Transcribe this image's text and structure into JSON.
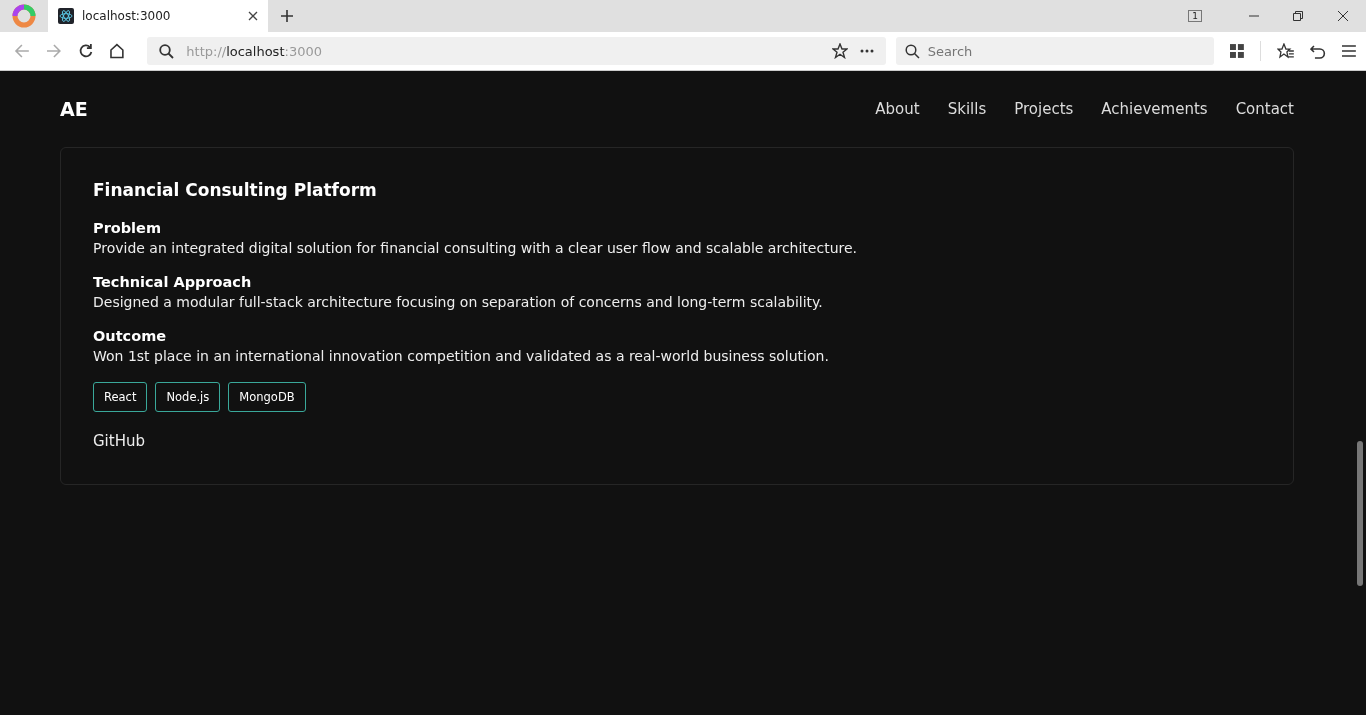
{
  "browser": {
    "tab": {
      "title": "localhost:3000"
    },
    "tab_count": "1",
    "address": {
      "scheme": "http://",
      "host": "localhost",
      "port": ":3000"
    },
    "search": {
      "placeholder": "Search"
    }
  },
  "nav": {
    "logo": "AE",
    "links": [
      "About",
      "Skills",
      "Projects",
      "Achievements",
      "Contact"
    ]
  },
  "project": {
    "title": "Financial Consulting Platform",
    "sections": [
      {
        "heading": "Problem",
        "text": "Provide an integrated digital solution for financial consulting with a clear user flow and scalable architecture."
      },
      {
        "heading": "Technical Approach",
        "text": "Designed a modular full-stack architecture focusing on separation of concerns and long-term scalability."
      },
      {
        "heading": "Outcome",
        "text": "Won 1st place in an international innovation competition and validated as a real-world business solution."
      }
    ],
    "tags": [
      "React",
      "Node.js",
      "MongoDB"
    ],
    "link": "GitHub"
  }
}
